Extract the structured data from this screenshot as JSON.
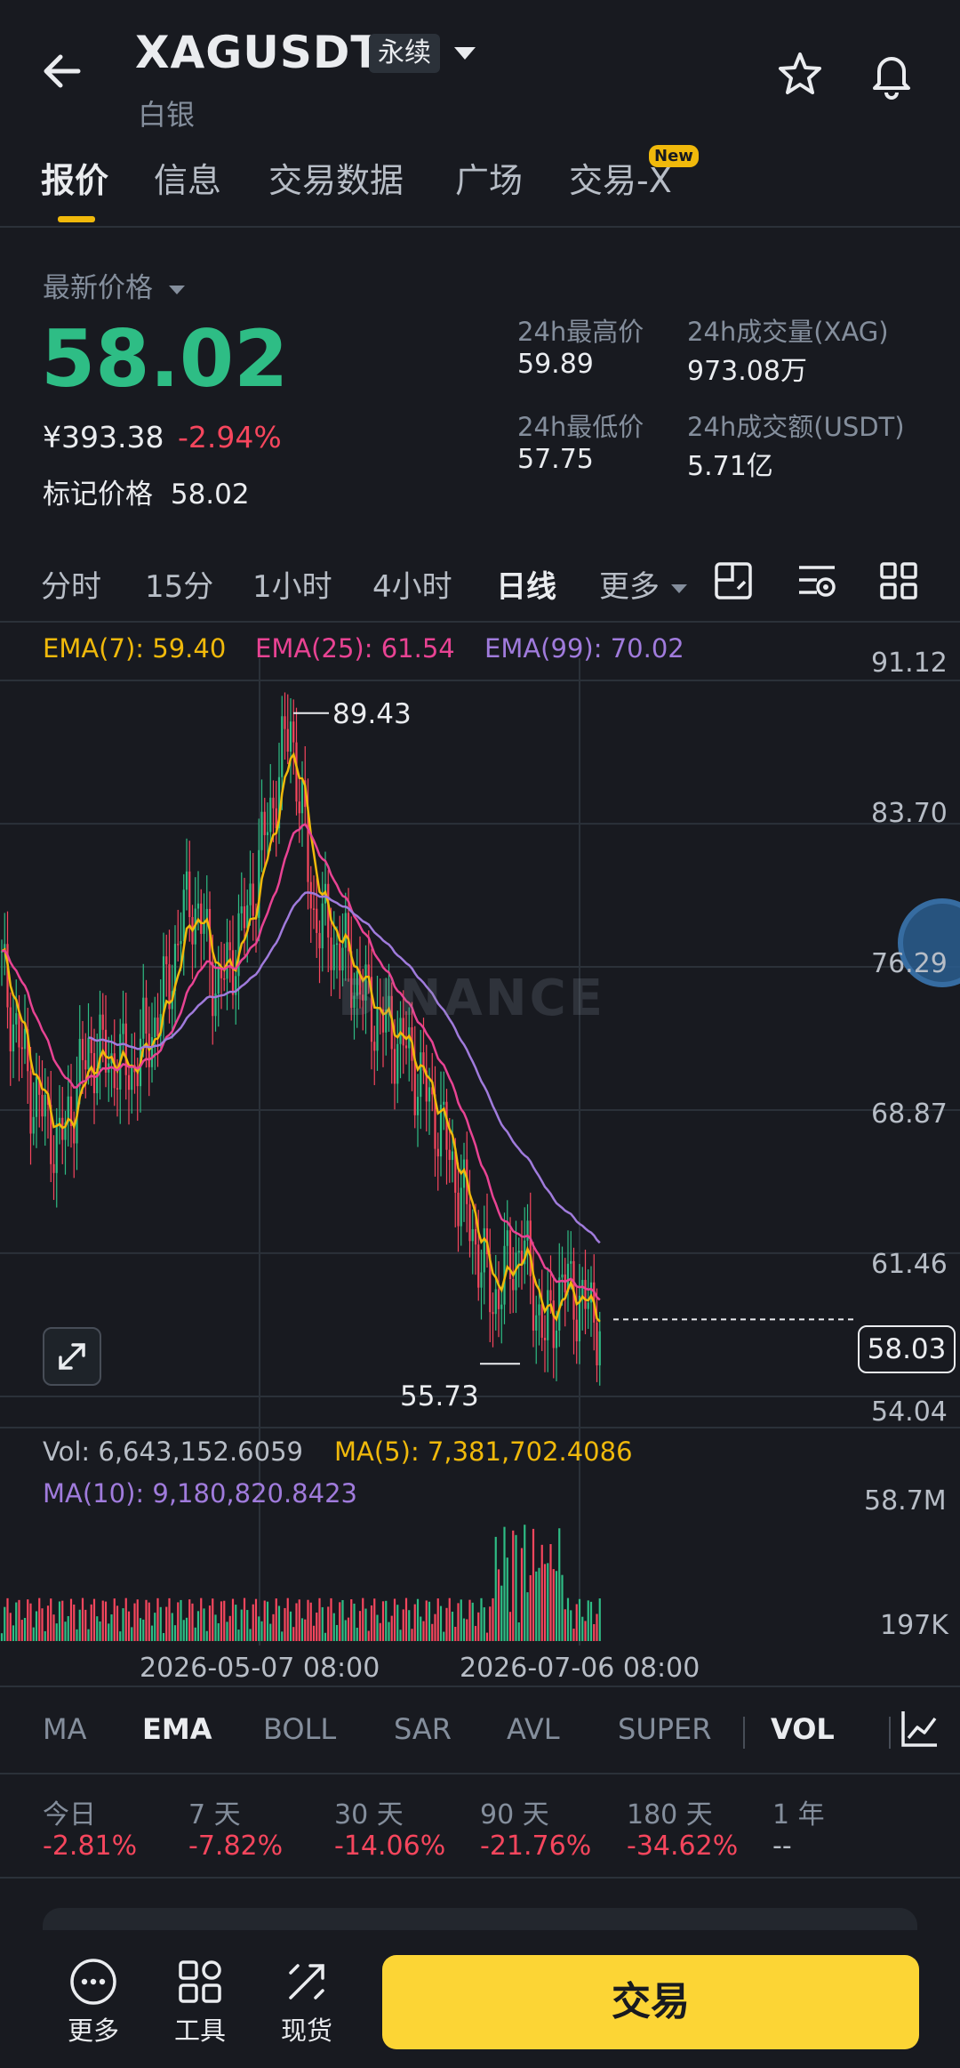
{
  "header": {
    "symbol": "XAGUSDT",
    "contract_type": "永续",
    "subtitle": "白银",
    "tabs": [
      {
        "label": "报价"
      },
      {
        "label": "信息"
      },
      {
        "label": "交易数据"
      },
      {
        "label": "广场"
      },
      {
        "label": "交易-X"
      }
    ],
    "new_badge": "New"
  },
  "price": {
    "latest_label": "最新价格",
    "last": "58.02",
    "cny": "¥393.38",
    "change": "-2.94%",
    "mark_label": "标记价格",
    "mark_value": "58.02",
    "stats": [
      {
        "label": "24h最高价",
        "value": "59.89"
      },
      {
        "label": "24h成交量(XAG)",
        "value": "973.08万"
      },
      {
        "label": "24h最低价",
        "value": "57.75"
      },
      {
        "label": "24h成交额(USDT)",
        "value": "5.71亿"
      }
    ]
  },
  "intervals": [
    "分时",
    "15分",
    "1小时",
    "4小时",
    "日线",
    "更多"
  ],
  "chart": {
    "watermark": "BINANCE",
    "ema_legend": [
      "EMA(7): 59.40",
      "EMA(25): 61.54",
      "EMA(99): 70.02"
    ],
    "y_ticks": [
      "91.12",
      "83.70",
      "76.29",
      "68.87",
      "61.46",
      "54.04"
    ],
    "high_label": "89.43",
    "low_label": "55.73",
    "current_price_tag": "58.03",
    "vol_legend": "Vol: 6,643,152.6059",
    "vol_ma5": "MA(5): 7,381,702.4086",
    "vol_ma10": "MA(10): 9,180,820.8423",
    "vol_ticks": [
      "58.7M",
      "197K"
    ],
    "x_labels": [
      "2026-05-07 08:00",
      "2026-07-06 08:00"
    ]
  },
  "chart_data": {
    "type": "candlestick",
    "ylim": [
      54.04,
      91.12
    ],
    "yticks": [
      91.12,
      83.7,
      76.29,
      68.87,
      61.46,
      54.04
    ],
    "x_labels": [
      "2026-05-07 08:00",
      "2026-07-06 08:00"
    ],
    "high_marker": 89.43,
    "low_marker": 55.73,
    "current_price": 58.03,
    "ema7_last": 59.4,
    "ema25_last": 61.54,
    "ema99_last": 70.02,
    "volume_ylim": [
      0.197,
      58.7
    ],
    "volume_unit": "M"
  },
  "indicators": [
    "MA",
    "EMA",
    "BOLL",
    "SAR",
    "AVL",
    "SUPER",
    "VOL"
  ],
  "performance": [
    {
      "label": "今日",
      "value": "-2.81%"
    },
    {
      "label": "7 天",
      "value": "-7.82%"
    },
    {
      "label": "30 天",
      "value": "-14.06%"
    },
    {
      "label": "90 天",
      "value": "-21.76%"
    },
    {
      "label": "180 天",
      "value": "-34.62%"
    },
    {
      "label": "1 年",
      "value": "--"
    }
  ],
  "footer": {
    "more": "更多",
    "tools": "工具",
    "spot": "现货",
    "trade": "交易"
  },
  "colors": {
    "up": "#2ebd85",
    "down": "#f6465d",
    "ema7": "#f0b90b",
    "ema25": "#e84393",
    "ema99": "#a07bdc",
    "accent": "#fcd535"
  }
}
